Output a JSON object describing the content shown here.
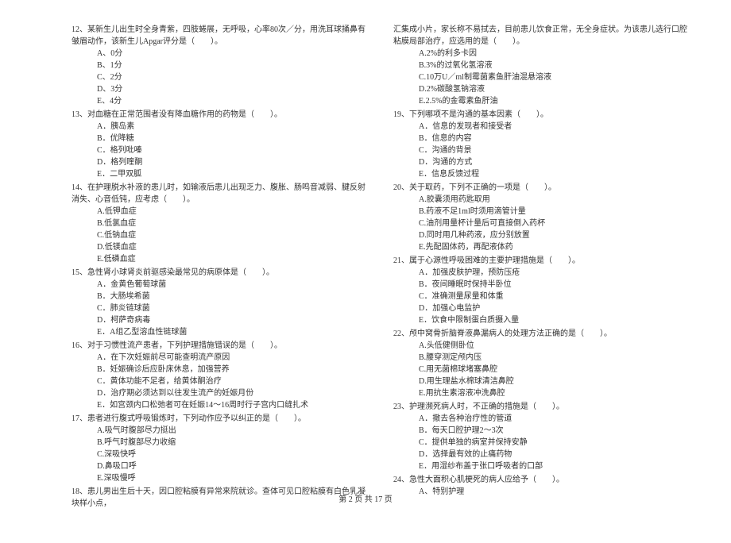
{
  "footer": "第 2 页 共 17 页",
  "left": {
    "q12": {
      "text": "12、某新生儿出生时全身青紫，四肢蜷展，无呼吸，心率80次／分，用洗耳球捅鼻有皱眉动作，该新生儿Apgar评分是（　　）。",
      "opts": [
        "A、0分",
        "B、1分",
        "C、2分",
        "D、3分",
        "E、4分"
      ]
    },
    "q13": {
      "text": "13、对血糖在正常范围者没有降血糖作用的药物是（　　）。",
      "opts": [
        "A．胰岛素",
        "B．优降糖",
        "C．格列吡嗪",
        "D．格列喹酮",
        "E．二甲双胍"
      ]
    },
    "q14": {
      "text": "14、在护理脱水补液的患儿时，如输液后患儿出现乏力、腹胀、肠鸣音减弱、腱反射消失、心音低钝，应考虑（　　）。",
      "opts": [
        "A.低钾血症",
        "B.低氯血症",
        "C.低钠血症",
        "D.低镁血症",
        "E.低磷血症"
      ]
    },
    "q15": {
      "text": "15、急性肾小球肾炎前驱感染最常见的病原体是（　　）。",
      "opts": [
        "A．金黄色葡萄球菌",
        "B．大肠埃希菌",
        "C．肺炎链球菌",
        "D．柯萨奇病毒",
        "E．A组乙型溶血性链球菌"
      ]
    },
    "q16": {
      "text": "16、对于习惯性流产患者，下列护理措施错误的是（　　）。",
      "opts": [
        "A．在下次妊娠前尽可能查明流产原因",
        "B．妊娠确诊后应卧床休息，加强营养",
        "C．黄体功能不足者，给黄体酮治疗",
        "D．治疗期必须达到以往发生流产的妊娠月份",
        "E．如宫颈内口松弛者可在妊娠14～16周时行子宫内口缝扎术"
      ]
    },
    "q17": {
      "text": "17、患者进行腹式呼吸锻炼时，下列动作应予以纠正的是（　　）。",
      "opts": [
        "A.吸气时腹部尽力挺出",
        "B.呼气时腹部尽力收缩",
        "C.深吸快呼",
        "D.鼻吸口呼",
        "E.深吸慢呼"
      ]
    },
    "q18": {
      "text": "18、患儿男出生后十天，因口腔粘膜有异常来院就诊。查体可见口腔粘膜有白色乳凝块样小点，"
    }
  },
  "right": {
    "q18cont": {
      "text": "汇集成小片，家长称不易拭去，目前患儿饮食正常，无全身症状。为该患儿选行口腔粘膜局部治疗，应选用的是（　　）。",
      "opts": [
        "A.2%的利多卡因",
        "B.3%的过氧化氢溶液",
        "C.10万U／ml制霉菌素鱼肝油混悬溶液",
        "D.2%碳酸氢钠溶液",
        "E.2.5%的金霉素鱼肝油"
      ]
    },
    "q19": {
      "text": "19、下列哪项不是沟通的基本因素（　　）。",
      "opts": [
        "A．信息的发现者和接受者",
        "B．信息的内容",
        "C．沟通的背景",
        "D．沟通的方式",
        "E．信息反馈过程"
      ]
    },
    "q20": {
      "text": "20、关于取药，下列不正确的一项是（　　）。",
      "opts": [
        "A.胶囊须用药匙取用",
        "B.药液不足1ml时须用滴管计量",
        "C.油剂用量杯计量后可直接倒入药杯",
        "D.同时用几种药液，应分别放置",
        "E.先配固体药，再配液体药"
      ]
    },
    "q21": {
      "text": "21、属于心源性呼吸困难的主要护理措施是（　　）。",
      "opts": [
        "A．加强皮肤护理，预防压疮",
        "B．夜间睡眠时保持半卧位",
        "C．准确测量尿量和体重",
        "D．加强心电监护",
        "E．饮食中限制蛋白质摄入量"
      ]
    },
    "q22": {
      "text": "22、颅中窝骨折脑脊液鼻漏病人的处理方法正确的是（　　）。",
      "opts": [
        "A.头低健侧卧位",
        "B.腰穿测定颅内压",
        "C.用无菌棉球堵塞鼻腔",
        "D.用生理盐水棉球清洁鼻腔",
        "E.用抗生素溶液冲洗鼻腔"
      ]
    },
    "q23": {
      "text": "23、护理濒死病人时，不正确的措施是（　　）。",
      "opts": [
        "A．撤去各种治疗性的管道",
        "B．每天口腔护理2～3次",
        "C．提供单独的病室并保持安静",
        "D．选择最有效的止痛药物",
        "E．用湿纱布盖于张口呼吸者的口部"
      ]
    },
    "q24": {
      "text": "24、急性大面积心肌梗死的病人应给予（　　）。",
      "opts": [
        "A、特别护理"
      ]
    }
  }
}
